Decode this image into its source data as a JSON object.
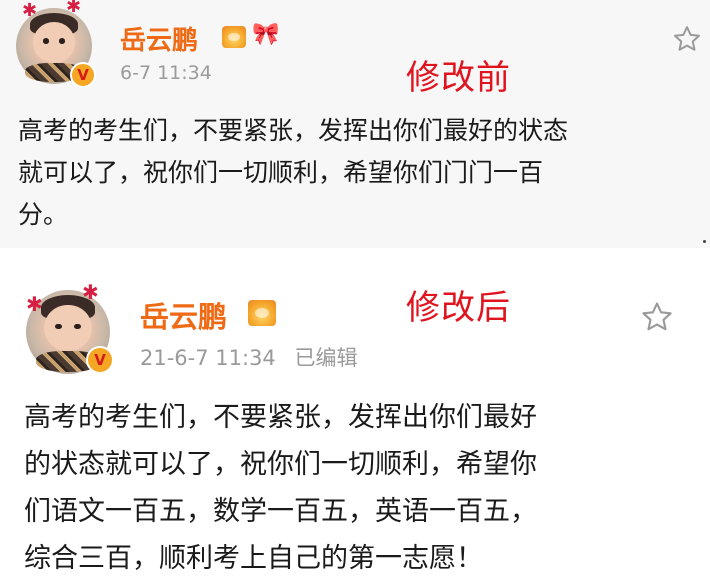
{
  "posts": [
    {
      "username": "岳云鹏",
      "timestamp": "6-7 11:34",
      "edited_label": "",
      "stamp_label": "修改前",
      "lines": [
        "高考的考生们，不要紧张，发挥出你们最好的状态",
        "就可以了，祝你们一切顺利，希望你们门门一百",
        "分。"
      ],
      "icons": [
        "avatar",
        "verified-badge-icon",
        "crown-badge-icon",
        "birthday-badge-icon",
        "star-icon"
      ]
    },
    {
      "username": "岳云鹏",
      "timestamp": "21-6-7 11:34",
      "edited_label": "已编辑",
      "stamp_label": "修改后",
      "lines": [
        "高考的考生们，不要紧张，发挥出你们最好",
        "的状态就可以了，祝你们一切顺利，希望你",
        "们语文一百五，数学一百五，英语一百五，",
        "综合三百，顺利考上自己的第一志愿！"
      ],
      "icons": [
        "avatar",
        "verified-badge-icon",
        "crown-badge-icon",
        "star-icon"
      ]
    }
  ],
  "badges": {
    "verified": "V"
  },
  "colors": {
    "username": "#ef6a14",
    "stamp": "#e0141e",
    "meta": "#9a9a9a",
    "body_text": "#1a1a1a",
    "before_card_bg": "#f7f7f7",
    "after_card_bg": "#ffffff"
  }
}
